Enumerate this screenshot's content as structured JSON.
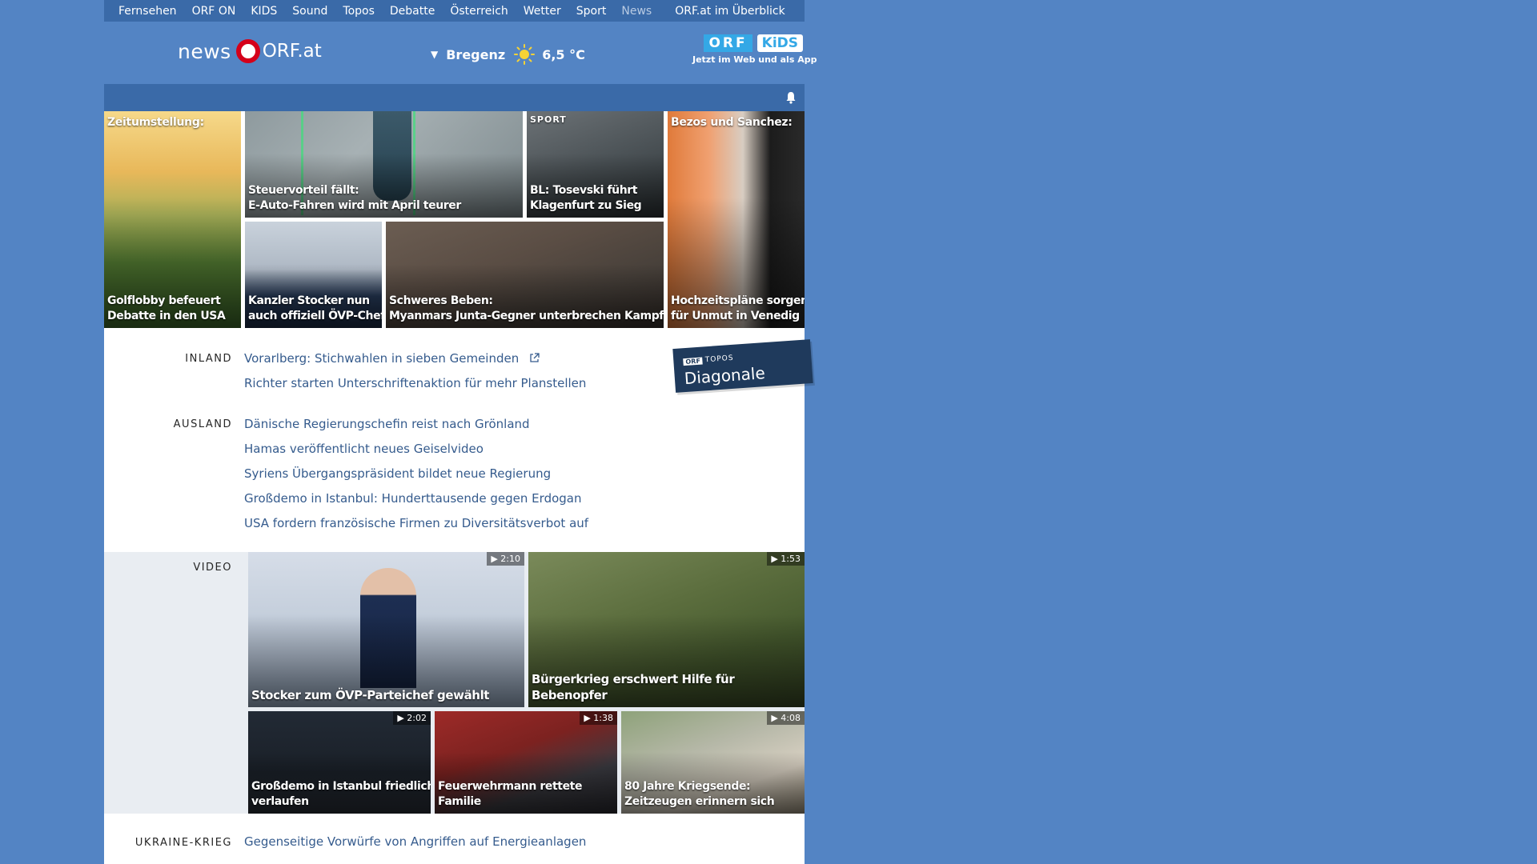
{
  "topnav": {
    "items": [
      "Fernsehen",
      "ORF ON",
      "KIDS",
      "Sound",
      "Topos",
      "Debatte",
      "Österreich",
      "Wetter",
      "Sport",
      "News"
    ],
    "active": "News",
    "overview": "ORF.at im Überblick"
  },
  "header": {
    "logo_news": "news",
    "logo_orf": "ORF.at",
    "weather": {
      "city": "Bregenz",
      "temperature": "6,5 °C",
      "icon": "sun-icon"
    },
    "kids_banner": {
      "orf": "ORF",
      "kids": "KiDS",
      "tagline": "Jetzt im Web und als App"
    }
  },
  "teasers": [
    {
      "kicker": "Zeitumstellung:",
      "title_lines": [
        "Golflobby befeuert",
        "Debatte in den USA"
      ]
    },
    {
      "title_lines": [
        "Steuervorteil fällt:",
        "E-Auto-Fahren wird mit April teurer"
      ]
    },
    {
      "tag": "SPORT",
      "title_lines": [
        "BL: Tosevski führt",
        "Klagenfurt zu Sieg"
      ]
    },
    {
      "kicker": "Bezos und Sanchez:",
      "title_lines": [
        "Hochzeitspläne sorgen",
        "für Unmut in Venedig"
      ]
    },
    {
      "title_lines": [
        "Kanzler Stocker nun",
        "auch offiziell ÖVP-Chef"
      ]
    },
    {
      "title_lines": [
        "Schweres Beben:",
        "Myanmars Junta-Gegner unterbrechen Kampf"
      ]
    }
  ],
  "sections": {
    "inland": {
      "label": "INLAND",
      "items": [
        "Vorarlberg: Stichwahlen in sieben Gemeinden",
        "Richter starten Unterschriftenaktion für mehr Planstellen"
      ]
    },
    "ausland": {
      "label": "AUSLAND",
      "items": [
        "Dänische Regierungschefin reist nach Grönland",
        "Hamas veröffentlicht neues Geiselvideo",
        "Syriens Übergangspräsident bildet neue Regierung",
        "Großdemo in Istanbul: Hunderttausende gegen Erdogan",
        "USA fordern französische Firmen zu Diversitätsverbot auf"
      ]
    },
    "video": {
      "label": "VIDEO",
      "items": [
        {
          "duration": "2:10",
          "title_lines": [
            "Stocker zum ÖVP-Parteichef gewählt"
          ]
        },
        {
          "duration": "1:53",
          "title_lines": [
            "Bürgerkrieg erschwert Hilfe für",
            "Bebenopfer"
          ]
        },
        {
          "duration": "2:02",
          "title_lines": [
            "Großdemo in Istanbul friedlich",
            "verlaufen"
          ]
        },
        {
          "duration": "1:38",
          "title_lines": [
            "Feuerwehrmann rettete",
            "Familie"
          ]
        },
        {
          "duration": "4:08",
          "title_lines": [
            "80 Jahre Kriegsende:",
            "Zeitzeugen erinnern sich"
          ]
        }
      ]
    },
    "ukraine": {
      "label": "UKRAINE-KRIEG",
      "items": [
        "Gegenseitige Vorwürfe von Angriffen auf Energieanlagen"
      ]
    }
  },
  "promo": {
    "brand": "ORF",
    "topos": "TOPOS",
    "name": "Diagonale"
  },
  "colors": {
    "page_bg": "#5384c4",
    "nav_bg": "#3a6aa8",
    "link": "#355b8d",
    "orf_red": "#d5001a",
    "video_bg": "#e9edf2"
  }
}
